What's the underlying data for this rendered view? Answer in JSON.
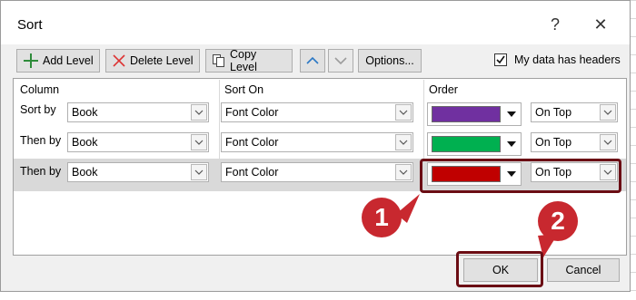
{
  "window": {
    "title": "Sort",
    "help_glyph": "?",
    "close_glyph": "✕"
  },
  "toolbar": {
    "add_level": "Add Level",
    "delete_level": "Delete Level",
    "copy_level": "Copy Level",
    "options": "Options...",
    "headers_checkbox_label": "My data has headers",
    "headers_checked": true
  },
  "columns": {
    "column": "Column",
    "sort_on": "Sort On",
    "order": "Order"
  },
  "rows": [
    {
      "label": "Sort by",
      "column": "Book",
      "sort_on": "Font Color",
      "color": "#7030a0",
      "position": "On Top"
    },
    {
      "label": "Then by",
      "column": "Book",
      "sort_on": "Font Color",
      "color": "#00b050",
      "position": "On Top"
    },
    {
      "label": "Then by",
      "column": "Book",
      "sort_on": "Font Color",
      "color": "#c00000",
      "position": "On Top"
    }
  ],
  "buttons": {
    "ok": "OK",
    "cancel": "Cancel"
  },
  "annotations": {
    "step1": "1",
    "step2": "2"
  },
  "colors": {
    "highlight": "#6b0d14",
    "badge": "#c8282f",
    "selected_row": "#d9d9d9"
  }
}
